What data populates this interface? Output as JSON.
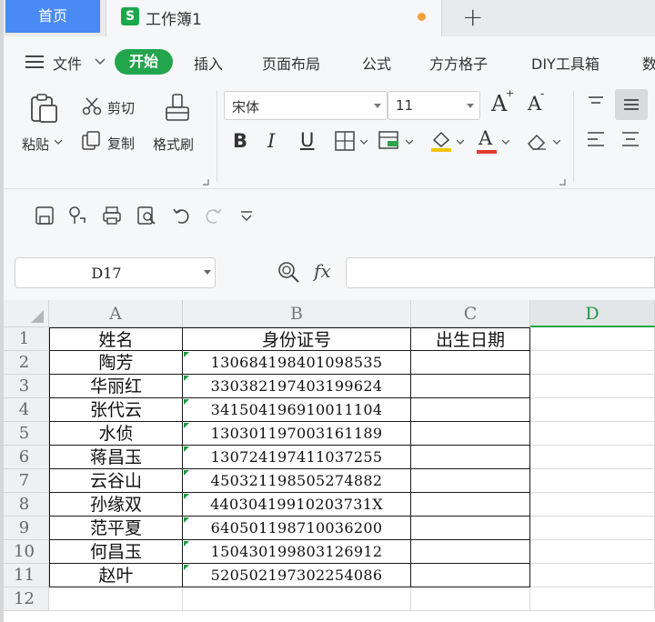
{
  "tabs": {
    "home": "首页",
    "workbook": "工作簿1",
    "workbook_logo": "S",
    "add": "+"
  },
  "menu": {
    "file": "文件",
    "start": "开始",
    "items": [
      "插入",
      "页面布局",
      "公式",
      "方方格子",
      "DIY工具箱",
      "数"
    ]
  },
  "ribbon": {
    "paste": "粘贴",
    "cut": "剪切",
    "copy": "复制",
    "format_painter": "格式刷",
    "font_name": "宋体",
    "font_size": "11",
    "bold": "B",
    "italic": "I",
    "underline": "U",
    "grow": "A",
    "shrink": "A",
    "font_color": "A"
  },
  "formula_bar": {
    "cell_ref": "D17",
    "fx": "fx",
    "value": ""
  },
  "sheet": {
    "columns": [
      "A",
      "B",
      "C",
      "D"
    ],
    "active_column": "D",
    "row_numbers": [
      "1",
      "2",
      "3",
      "4",
      "5",
      "6",
      "7",
      "8",
      "9",
      "10",
      "11",
      "12"
    ],
    "headers": {
      "name": "姓名",
      "id": "身份证号",
      "birth": "出生日期"
    },
    "rows": [
      {
        "name": "陶芳",
        "id": "130684198401098535",
        "birth": ""
      },
      {
        "name": "华丽红",
        "id": "330382197403199624",
        "birth": ""
      },
      {
        "name": "张代云",
        "id": "341504196910011104",
        "birth": ""
      },
      {
        "name": "水侦",
        "id": "130301197003161189",
        "birth": ""
      },
      {
        "name": "蒋昌玉",
        "id": "130724197411037255",
        "birth": ""
      },
      {
        "name": "云谷山",
        "id": "450321198505274882",
        "birth": ""
      },
      {
        "name": "孙缘双",
        "id": "44030419910203731X",
        "birth": ""
      },
      {
        "name": "范平夏",
        "id": "640501198710036200",
        "birth": ""
      },
      {
        "name": "何昌玉",
        "id": "150430199803126912",
        "birth": ""
      },
      {
        "name": "赵叶",
        "id": "520502197302254086",
        "birth": ""
      }
    ]
  },
  "colors": {
    "accent_green": "#1ea64a",
    "home_tab_blue": "#4a8af4",
    "modified_dot": "#f5a139",
    "font_color_bar": "#e23a2e",
    "fill_color_bar": "#f1c40f"
  }
}
